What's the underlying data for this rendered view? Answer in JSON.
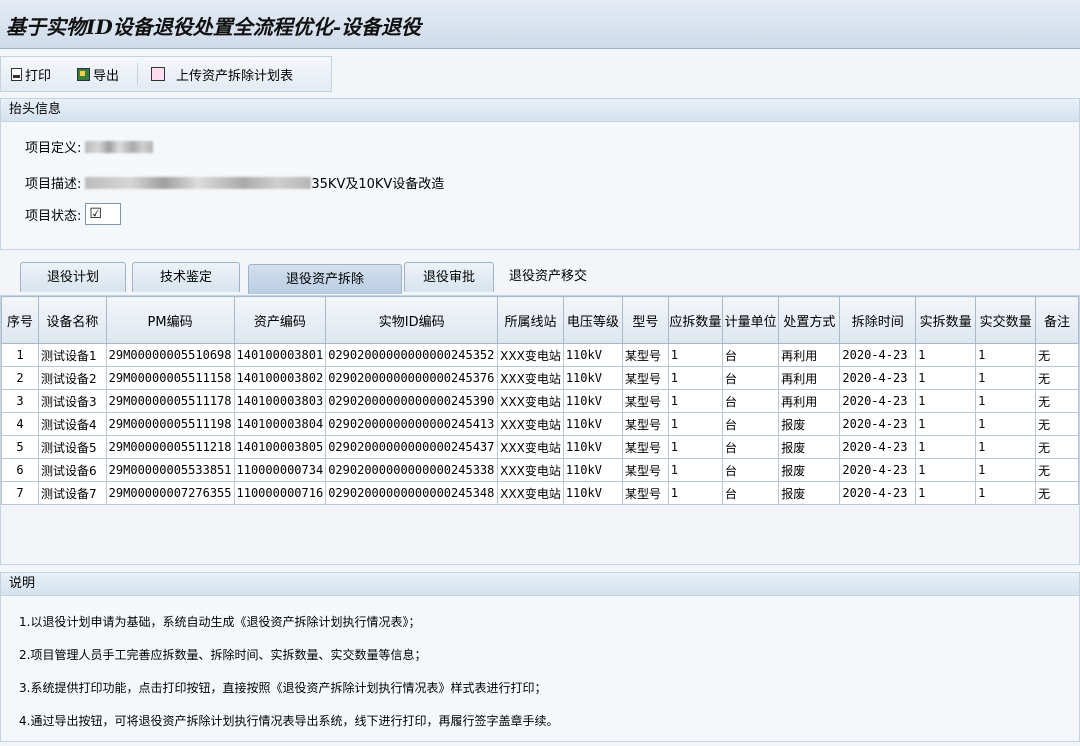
{
  "window": {
    "title": "基于实物ID设备退役处置全流程优化-设备退役"
  },
  "toolbar": {
    "print_label": "打印",
    "export_label": "导出",
    "upload_label": "上传资产拆除计划表"
  },
  "header_panel": {
    "title": "抬头信息",
    "project_def_label": "项目定义:",
    "project_desc_label": "项目描述:",
    "project_desc_visible": "35KV及10KV设备改造",
    "project_status_label": "项目状态:",
    "project_status_value": "☑"
  },
  "tabs": [
    {
      "label": "退役计划"
    },
    {
      "label": "技术鉴定"
    },
    {
      "label": "退役资产拆除"
    },
    {
      "label": "退役审批"
    },
    {
      "label": "退役资产移交"
    }
  ],
  "table": {
    "columns": [
      "序号",
      "设备名称",
      "PM编码",
      "资产编码",
      "实物ID编码",
      "所属线站",
      "电压等级",
      "型号",
      "应拆数量",
      "计量单位",
      "处置方式",
      "拆除时间",
      "实拆数量",
      "实交数量",
      "备注"
    ],
    "rows": [
      [
        "1",
        "测试设备1",
        "29M00000005510698",
        "140100003801",
        "02902000000000000245352",
        "XXX变电站",
        "110kV",
        "某型号",
        "1",
        "台",
        "再利用",
        "2020-4-23",
        "1",
        "1",
        "无"
      ],
      [
        "2",
        "测试设备2",
        "29M00000005511158",
        "140100003802",
        "02902000000000000245376",
        "XXX变电站",
        "110kV",
        "某型号",
        "1",
        "台",
        "再利用",
        "2020-4-23",
        "1",
        "1",
        "无"
      ],
      [
        "3",
        "测试设备3",
        "29M00000005511178",
        "140100003803",
        "02902000000000000245390",
        "XXX变电站",
        "110kV",
        "某型号",
        "1",
        "台",
        "再利用",
        "2020-4-23",
        "1",
        "1",
        "无"
      ],
      [
        "4",
        "测试设备4",
        "29M00000005511198",
        "140100003804",
        "02902000000000000245413",
        "XXX变电站",
        "110kV",
        "某型号",
        "1",
        "台",
        "报废",
        "2020-4-23",
        "1",
        "1",
        "无"
      ],
      [
        "5",
        "测试设备5",
        "29M00000005511218",
        "140100003805",
        "02902000000000000245437",
        "XXX变电站",
        "110kV",
        "某型号",
        "1",
        "台",
        "报废",
        "2020-4-23",
        "1",
        "1",
        "无"
      ],
      [
        "6",
        "测试设备6",
        "29M00000005533851",
        "110000000734",
        "02902000000000000245338",
        "XXX变电站",
        "110kV",
        "某型号",
        "1",
        "台",
        "报废",
        "2020-4-23",
        "1",
        "1",
        "无"
      ],
      [
        "7",
        "测试设备7",
        "29M00000007276355",
        "110000000716",
        "02902000000000000245348",
        "XXX变电站",
        "110kV",
        "某型号",
        "1",
        "台",
        "报废",
        "2020-4-23",
        "1",
        "1",
        "无"
      ]
    ]
  },
  "notes": {
    "title": "说明",
    "items": [
      "1.以退役计划申请为基础，系统自动生成《退役资产拆除计划执行情况表》；",
      "2.项目管理人员手工完善应拆数量、拆除时间、实拆数量、实交数量等信息；",
      "3.系统提供打印功能，点击打印按钮，直接按照《退役资产拆除计划执行情况表》样式表进行打印；",
      "4.通过导出按钮，可将退役资产拆除计划执行情况表导出系统，线下进行打印，再履行签字盖章手续。"
    ]
  }
}
